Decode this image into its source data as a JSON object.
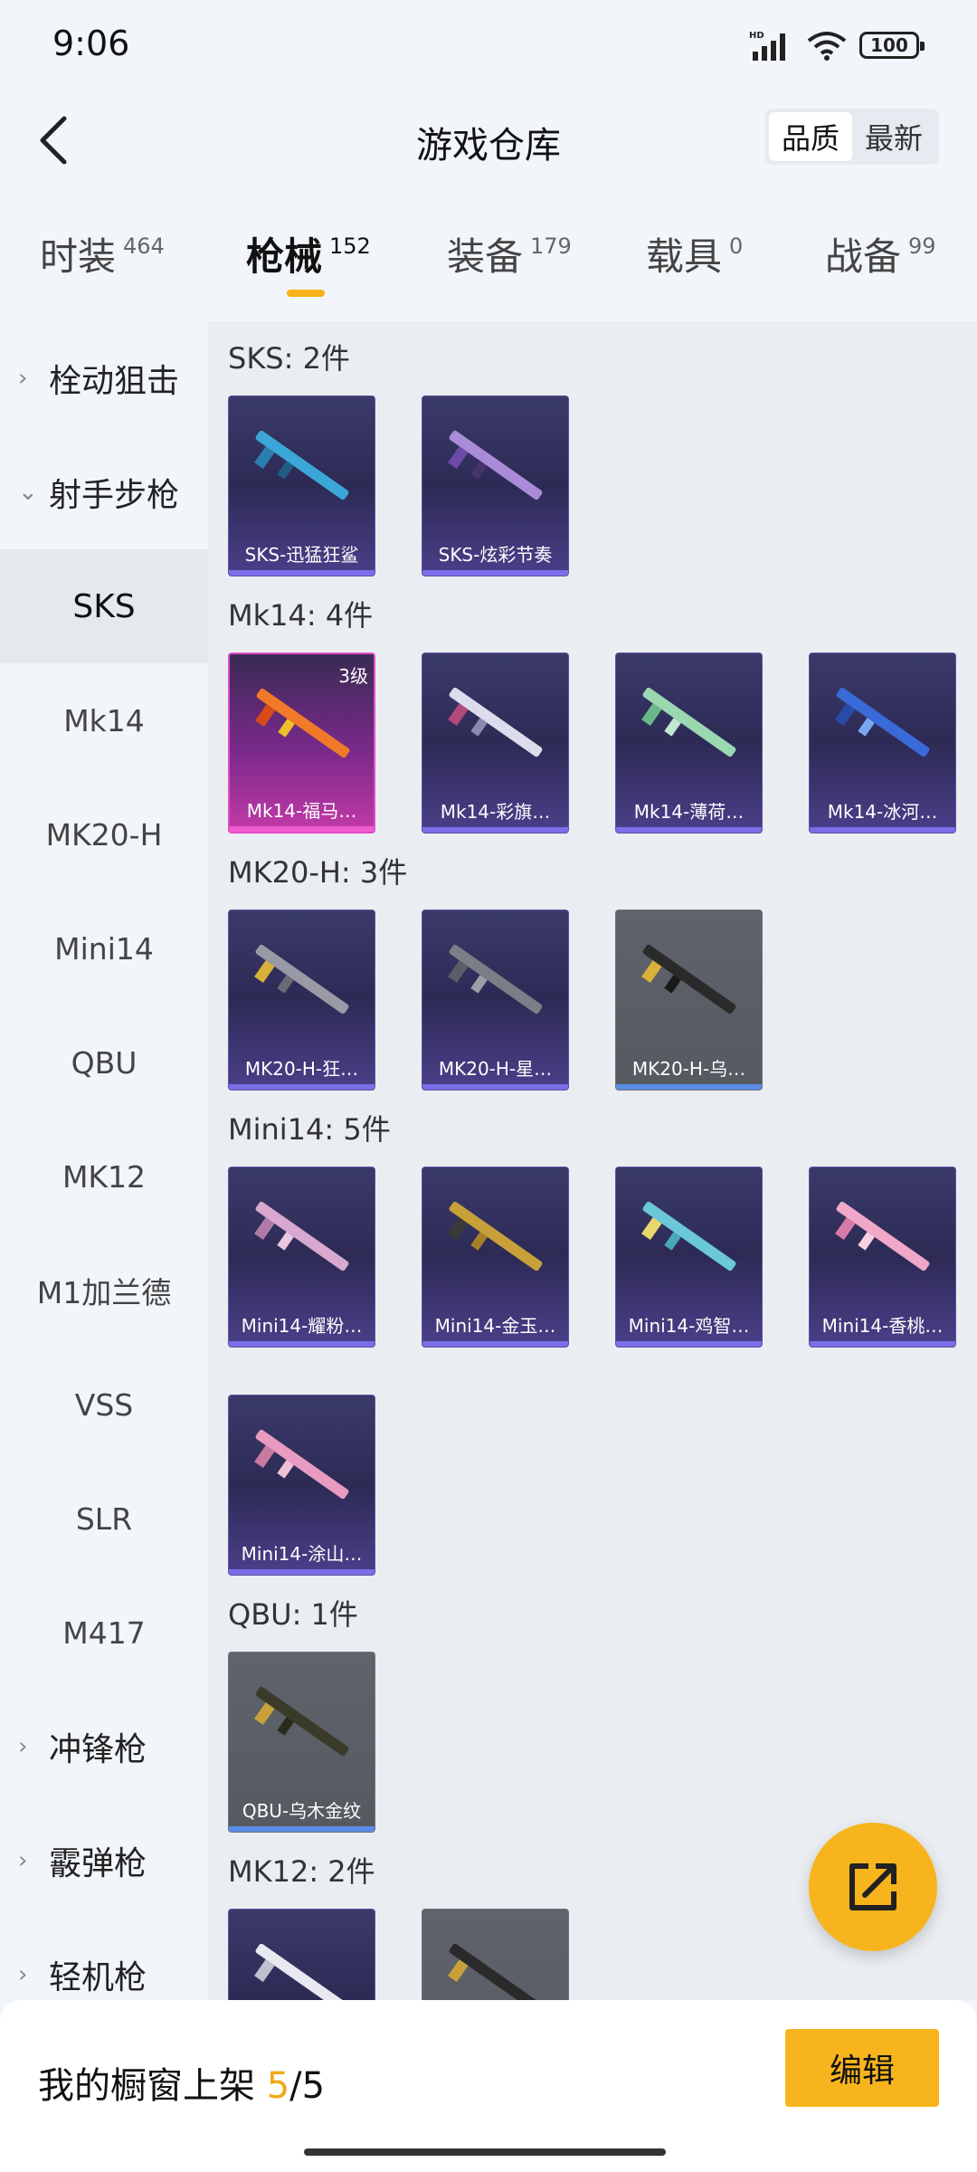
{
  "status_bar": {
    "time": "9:06",
    "hd": "HD",
    "battery": "100"
  },
  "header": {
    "title": "游戏仓库",
    "sort_options": [
      "品质",
      "最新"
    ],
    "active_sort": 0
  },
  "tabs": [
    {
      "label": "时装",
      "count": "464"
    },
    {
      "label": "枪械",
      "count": "152"
    },
    {
      "label": "装备",
      "count": "179"
    },
    {
      "label": "载具",
      "count": "0"
    },
    {
      "label": "战备",
      "count": "99"
    }
  ],
  "active_tab": 1,
  "sidebar": {
    "groups_top": [
      {
        "label": "栓动狙击"
      },
      {
        "label": "射手步枪"
      }
    ],
    "sub_items": [
      "SKS",
      "Mk14",
      "MK20-H",
      "Mini14",
      "QBU",
      "MK12",
      "M1加兰德",
      "VSS",
      "SLR",
      "M417"
    ],
    "groups_bottom": [
      {
        "label": "冲锋枪"
      },
      {
        "label": "霰弹枪"
      },
      {
        "label": "轻机枪"
      }
    ]
  },
  "sections": [
    {
      "title": "SKS: 2件",
      "items": [
        {
          "label": "SKS-迅猛狂鲨",
          "style": "purple"
        },
        {
          "label": "SKS-炫彩节奏",
          "style": "purple"
        }
      ]
    },
    {
      "title": "Mk14: 4件",
      "items": [
        {
          "label": "Mk14-福马…",
          "style": "pink",
          "level": "3级"
        },
        {
          "label": "Mk14-彩旗…",
          "style": "purple"
        },
        {
          "label": "Mk14-薄荷…",
          "style": "purple"
        },
        {
          "label": "Mk14-冰河…",
          "style": "purple"
        }
      ]
    },
    {
      "title": "MK20-H: 3件",
      "items": [
        {
          "label": "MK20-H-狂…",
          "style": "purple"
        },
        {
          "label": "MK20-H-星…",
          "style": "purple"
        },
        {
          "label": "MK20-H-乌…",
          "style": "gray"
        }
      ]
    },
    {
      "title": "Mini14: 5件",
      "items": [
        {
          "label": "Mini14-耀粉…",
          "style": "purple"
        },
        {
          "label": "Mini14-金玉…",
          "style": "purple"
        },
        {
          "label": "Mini14-鸡智…",
          "style": "purple"
        },
        {
          "label": "Mini14-香桃…",
          "style": "purple"
        },
        {
          "label": "Mini14-涂山…",
          "style": "purple"
        }
      ]
    },
    {
      "title": "QBU: 1件",
      "items": [
        {
          "label": "QBU-乌木金纹",
          "style": "gray"
        }
      ]
    },
    {
      "title": "MK12: 2件",
      "items": [
        {
          "label": "",
          "style": "purple"
        },
        {
          "label": "",
          "style": "gray"
        }
      ]
    }
  ],
  "bottom_bar": {
    "shelf_label": "我的橱窗上架",
    "shelf_count": "5",
    "shelf_sep": "/",
    "shelf_total": "5",
    "edit_label": "编辑"
  },
  "colors": {
    "accent": "#f8b41c",
    "purple_card": "#2d2a55",
    "gray_card": "#5f636b",
    "pink_card": "#c23aa8"
  },
  "icons": {
    "back": "back-arrow-icon",
    "share": "share-external-icon",
    "signal": "signal-icon",
    "wifi": "wifi-icon"
  }
}
